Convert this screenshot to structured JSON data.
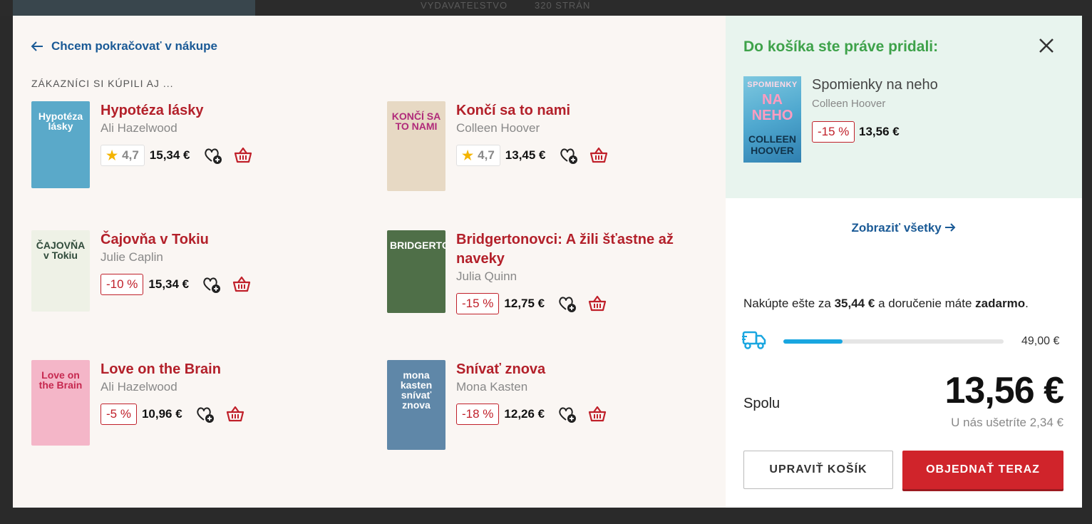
{
  "background": {
    "text_fragments": [
      "VYDAVATEĽSTVO",
      "320 STRÁN"
    ]
  },
  "left": {
    "back_link": "Chcem pokračovať v nákupe",
    "section_title": "ZÁKAZNÍCI SI KÚPILI AJ ...",
    "products": [
      {
        "title": "Hypotéza lásky",
        "author": "Ali Hazelwood",
        "rating": "4,7",
        "discount": "",
        "price": "15,34 €",
        "cover": {
          "bg": "#5aa9c9",
          "text": "Hypotéza lásky",
          "text_color": "#ffffff"
        }
      },
      {
        "title": "Končí sa to nami",
        "author": "Colleen Hoover",
        "rating": "4,7",
        "discount": "",
        "price": "13,45 €",
        "cover": {
          "bg": "#e7d9c4",
          "text": "KONČÍ SA TO NAMI",
          "text_color": "#b02a7a"
        }
      },
      {
        "title": "Čajovňa v Tokiu",
        "author": "Julie Caplin",
        "rating": "",
        "discount": "-10 %",
        "price": "15,34 €",
        "cover": {
          "bg": "#eef1e6",
          "text": "ČAJOVŇA v Tokiu",
          "text_color": "#2f4a3a"
        }
      },
      {
        "title": "Bridgertonovci: A žili šťastne až naveky",
        "author": "Julia Quinn",
        "rating": "",
        "discount": "-15 %",
        "price": "12,75 €",
        "cover": {
          "bg": "#4f6f48",
          "text": "BRIDGERTON",
          "text_color": "#ffffff"
        }
      },
      {
        "title": "Love on the Brain",
        "author": "Ali Hazelwood",
        "rating": "",
        "discount": "-5 %",
        "price": "10,96 €",
        "cover": {
          "bg": "#f4b6c8",
          "text": "Love on the Brain",
          "text_color": "#c6284f"
        }
      },
      {
        "title": "Snívať znova",
        "author": "Mona Kasten",
        "rating": "",
        "discount": "-18 %",
        "price": "12,26 €",
        "cover": {
          "bg": "#5f87a8",
          "text": "mona kasten snívať znova",
          "text_color": "#ffffff"
        }
      }
    ]
  },
  "right": {
    "added_title": "Do košíka ste práve pridali:",
    "added_item": {
      "title": "Spomienky na neho",
      "author": "Colleen Hoover",
      "discount": "-15 %",
      "price": "13,56 €",
      "cover_text_1": "SPOMIENKY",
      "cover_text_2": "NA NEHO",
      "cover_text_3": "COLLEEN HOOVER"
    },
    "show_all": "Zobraziť všetky",
    "shipping": {
      "prefix": "Nakúpte ešte za",
      "amount": "35,44 €",
      "middle": "a doručenie máte",
      "free": "zadarmo",
      "suffix": ".",
      "threshold": "49,00 €",
      "progress_fraction": 0.27
    },
    "total_label": "Spolu",
    "total_price": "13,56 €",
    "savings": "U nás ušetríte 2,34 €",
    "edit_button": "UPRAVIŤ KOŠÍK",
    "order_button": "OBJEDNAŤ TERAZ"
  },
  "colors": {
    "accent_red": "#c0202a",
    "link_blue": "#1a5a96",
    "success_green": "#3ea24a",
    "progress_blue": "#19a6e0",
    "rating_star": "#f4b400"
  },
  "icons": [
    "arrow-left-icon",
    "star-icon",
    "wishlist-add-icon",
    "cart-icon",
    "close-icon",
    "arrow-right-icon",
    "truck-icon"
  ]
}
